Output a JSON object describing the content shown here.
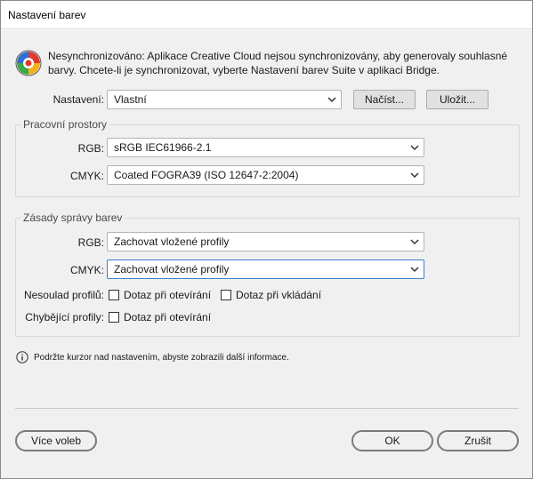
{
  "window": {
    "title": "Nastavení barev"
  },
  "notice": {
    "icon": "color-wheel-icon",
    "line1": "Nesynchronizováno: Aplikace Creative Cloud nejsou synchronizovány, aby generovaly souhlasné",
    "line2": "barvy. Chcete-li je synchronizovat, vyberte Nastavení barev Suite v aplikaci Bridge."
  },
  "settings": {
    "label": "Nastavení:",
    "value": "Vlastní",
    "load_button": "Načíst...",
    "save_button": "Uložit..."
  },
  "working_spaces": {
    "title": "Pracovní prostory",
    "rgb_label": "RGB:",
    "rgb_value": "sRGB IEC61966-2.1",
    "cmyk_label": "CMYK:",
    "cmyk_value": "Coated FOGRA39 (ISO 12647-2:2004)"
  },
  "policies": {
    "title": "Zásady správy barev",
    "rgb_label": "RGB:",
    "rgb_value": "Zachovat vložené profily",
    "cmyk_label": "CMYK:",
    "cmyk_value": "Zachovat vložené profily",
    "mismatch_label": "Nesoulad profilů:",
    "mismatch_open": "Dotaz při otevírání",
    "mismatch_open_checked": false,
    "mismatch_paste": "Dotaz při vkládání",
    "mismatch_paste_checked": false,
    "missing_label": "Chybějící profily:",
    "missing_open": "Dotaz při otevírání",
    "missing_open_checked": false
  },
  "info": {
    "icon": "info-icon",
    "text": "Podržte kurzor nad nastavením, abyste zobrazili další informace."
  },
  "footer": {
    "more_options": "Více voleb",
    "ok": "OK",
    "cancel": "Zrušit"
  }
}
